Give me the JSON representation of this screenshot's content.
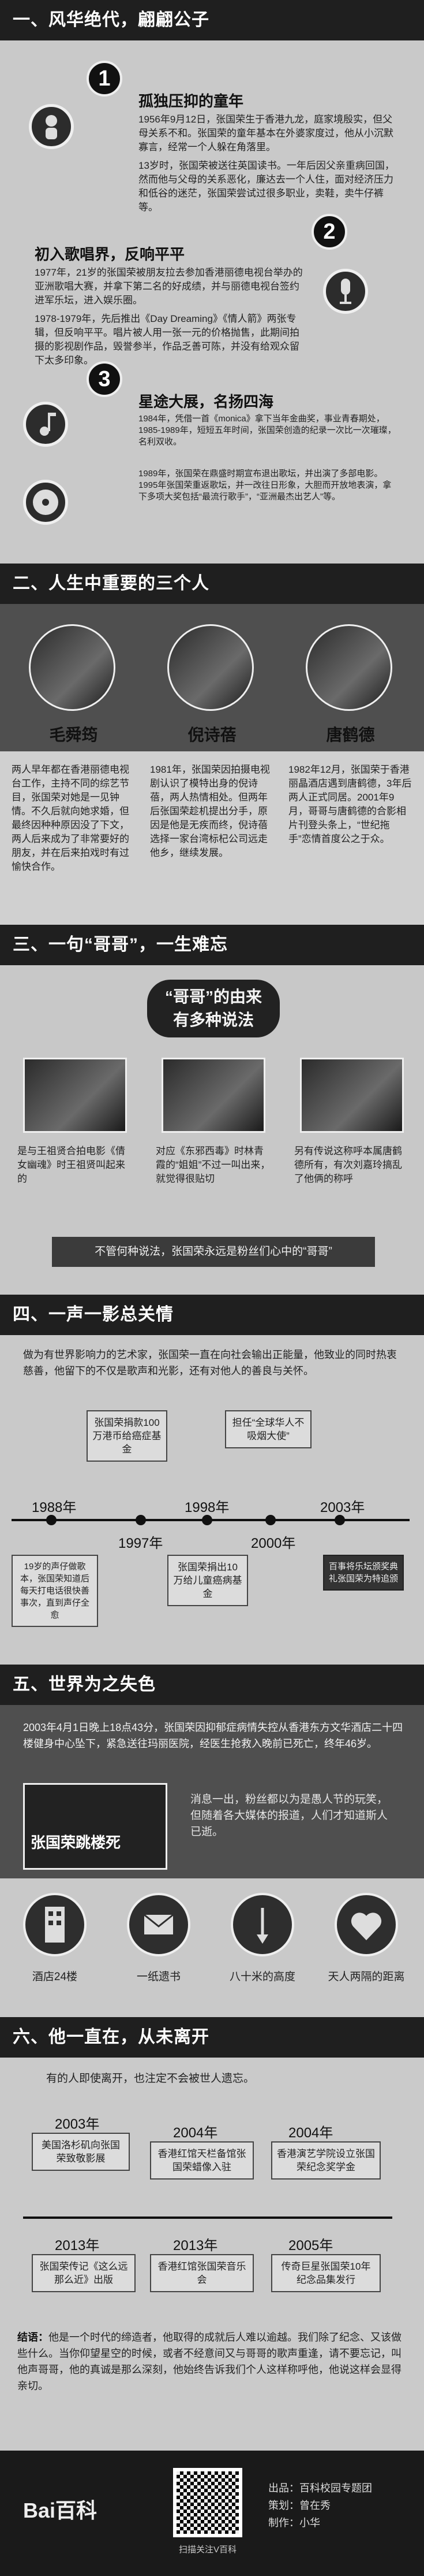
{
  "sections": {
    "s1": "一、风华绝代，翩翩公子",
    "s2": "二、人生中重要的三个人",
    "s3": "三、一句“哥哥”，一生难忘",
    "s4": "四、一声一影总关情",
    "s5": "五、世界为之失色",
    "s6": "六、他一直在，从未离开"
  },
  "s1": {
    "b1_title": "孤独压抑的童年",
    "b1_p1": "1956年9月12日，张国荣生于香港九龙，庭家境殷实，但父母关系不和。张国荣的童年基本在外婆家度过，他从小沉默寡言，经常一个人躲在角落里。",
    "b1_p2": "13岁时，张国荣被送往英国读书。一年后因父亲重病回国，然而他与父母的关系恶化，廉达去一个人住，面对经济压力和低谷的迷茫，张国荣尝试过很多职业，卖鞋，卖牛仔裤等。",
    "b2_title": "初入歌唱界，反响平平",
    "b2_p1": "1977年，21岁的张国荣被朋友拉去参加香港丽德电视台举办的亚洲歌唱大赛，并拿下第二名的好成绩，并与丽德电视台签约进军乐坛，进入娱乐圈。",
    "b2_p2": "1978-1979年，先后推出《Day Dreaming》《情人箭》两张专辑，但反响平平。唱片被人用一张一元的价格抛售，此期间拍摄的影视剧作品，毁誉参半，作品乏善可陈，并没有给观众留下太多印象。",
    "b3_title": "星途大展，名扬四海",
    "b3_p1": "1984年，凭借一首《monica》拿下当年金曲奖，事业青春期处，1985-1989年，短短五年时间，张国荣创造的纪录一次比一次璀璨，名利双收。",
    "b3_p2": "1989年，张国荣在鼎盛时期宣布退出歌坛，并出演了多部电影。1995年张国荣重返歌坛，并一改往日形象，大胆而开放地表演，拿下多项大奖包括“最流行歌手”，“亚洲最杰出艺人”等。"
  },
  "s2": {
    "p1_name": "毛舜筠",
    "p1_text": "两人早年都在香港丽德电视台工作，主持不同的综艺节目，张国荣对她是一见钟情。不久后就向她求婚，但最终因种种原因没了下文，两人后来成为了非常要好的朋友，并在后来拍戏时有过愉快合作。",
    "p2_name": "倪诗蓓",
    "p2_text": "1981年，张国荣因拍摄电视剧认识了模特出身的倪诗蓓，两人热情相处。但两年后张国荣趁机提出分手，原因是他是无疾而终，倪诗蓓选择一家台湾标杞公司远走他乡，继续发展。",
    "p3_name": "唐鹤德",
    "p3_text": "1982年12月，张国荣于香港丽晶酒店遇到唐鹤德，3年后两人正式同居。2001年9月，哥哥与唐鹤德的合影相片刊登头条上，“世纪拖手”恋情首度公之于众。"
  },
  "s3": {
    "bubble_l1": "“哥哥”的由来",
    "bubble_l2": "有多种说法",
    "c1": "是与王祖贤合拍电影《倩女幽魂》时王祖贤叫起来的",
    "c2": "对应《东邪西毒》时林青霞的“姐姐”不过一叫出来，就觉得很贴切",
    "c3": "另有传说这称呼本属唐鹤德所有，有次刘嘉玲搞乱了他俩的称呼",
    "summary": "不管何种说法，张国荣永远是粉丝们心中的“哥哥”"
  },
  "s4": {
    "intro": "做为有世界影响力的艺术家，张国荣一直在向社会输出正能量，他致业的同时热衷慈善，他留下的不仅是歌声和光影，还有对他人的善良与关怀。",
    "y1": "1988年",
    "y2": "1997年",
    "y3": "1998年",
    "y4": "2000年",
    "y5": "2003年",
    "e1": "19岁的声仔做歌本，张国荣知道后每天打电话很快善事次，直到声仔全愈",
    "e2": "张国荣捐款100万港币给癌症基金",
    "e3": "张国荣捐出10万给儿童癌病基金",
    "e4": "担任“全球华人不吸烟大使”",
    "e5": "百事将乐坛颁奖典礼张国荣为特追颁"
  },
  "s5": {
    "news": "2003年4月1日晚上18点43分，张国荣因抑郁症病情失控从香港东方文华酒店二十四楼健身中心坠下，紧急送往玛丽医院，经医生抢救入晚前已死亡，终年46岁。",
    "photo_text": "张国荣跳楼死",
    "quote": "消息一出，粉丝都以为是愚人节的玩笑，但随着各大媒体的报道，人们才知道斯人已逝。",
    "stat1": "酒店24楼",
    "stat2": "一纸遗书",
    "stat3": "八十米的高度",
    "stat4": "天人两隔的距离"
  },
  "s6": {
    "intro": "有的人即使离开，也注定不会被世人遗忘。",
    "t1_year": "2003年",
    "t1_text": "美国洛杉矶向张国荣致敬影展",
    "t2_year": "2004年",
    "t2_text": "香港红馆天栏备馆张国荣蜡像入驻",
    "t3_year": "2004年",
    "t3_text": "香港演艺学院设立张国荣纪念奖学金",
    "t4_year": "2013年",
    "t4_text": "张国荣传记《这么远那么近》出版",
    "t5_year": "2013年",
    "t5_text": "香港红馆张国荣音乐会",
    "t6_year": "2005年",
    "t6_text": "传奇巨星张国荣10年纪念品集发行",
    "conclusion_label": "结语：",
    "conclusion": "他是一个时代的缔造者，他取得的成就后人难以逾越。我们除了纪念、又该做些什么。当你仰望星空的时候，或者不经意间又与哥哥的歌声重逢，请不要忘记，叫他声哥哥，他的真诚是那么深刻，他始终告诉我们个人这样称呼他，他说这样会显得亲切。"
  },
  "footer": {
    "logo": "Bai百科",
    "qr_caption": "扫描关注V百科",
    "c1": "出品：百科校园专题团",
    "c2": "策划：曾在秀",
    "c3": "制作：小华"
  }
}
